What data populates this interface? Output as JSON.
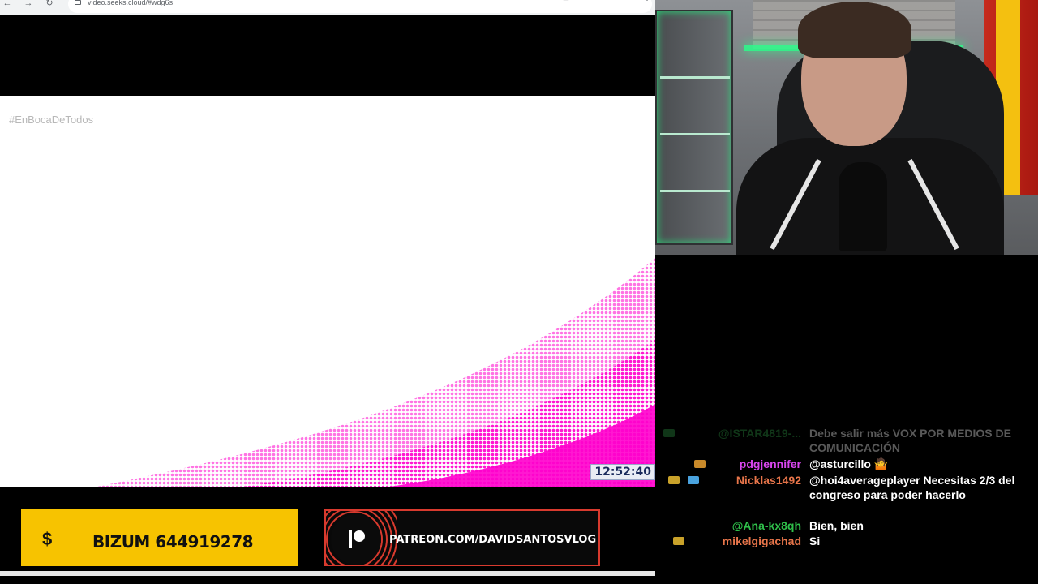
{
  "browser": {
    "url": "video.seeks.cloud/#wdg6s",
    "hashtag": "#EnBocaDeTodos",
    "clock": "12:52:40"
  },
  "chat": {
    "messages": [
      {
        "user": "@ISTAR4819-...",
        "text": "Debe salir más VOX POR MEDIOS DE COMUNICACIÓN",
        "user_color": "#2e9c45",
        "faded": true
      },
      {
        "user": "pdgjennifer",
        "text": "@asturcillo 🤷",
        "user_color": "#d946ef"
      },
      {
        "user": "Nicklas1492",
        "text": "@hoi4averageplayer Necesitas 2/3 del congreso para poder hacerlo",
        "user_color": "#e8754a"
      },
      {
        "user": "@Ana-kx8qh",
        "text": "Bien, bien",
        "user_color": "#2fbf4a"
      },
      {
        "user": "mikelgigachad",
        "text": "Si",
        "user_color": "#e8754a"
      }
    ]
  },
  "banners": {
    "bizum_symbol": "$",
    "bizum_text": "BIZUM 644919278",
    "patreon_text": "PATREON.COM/DAVIDSANTOSVLOG"
  },
  "colors": {
    "bizum_bg": "#f7c300",
    "patreon_border": "#d83a2e",
    "magenta": "#ff00cc"
  }
}
